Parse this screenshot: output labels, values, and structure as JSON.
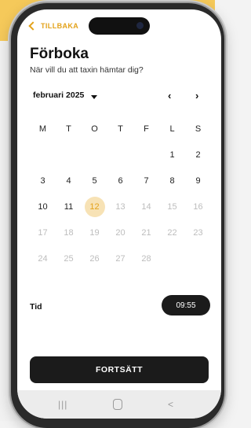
{
  "header": {
    "back_label": "TILLBAKA",
    "title": "Förboka",
    "subtitle": "När vill du att taxin hämtar dig?"
  },
  "calendar": {
    "month_label": "februari 2025",
    "prev_icon": "chevron-left-icon",
    "next_icon": "chevron-right-icon",
    "weekdays": [
      "M",
      "T",
      "O",
      "T",
      "F",
      "L",
      "S"
    ],
    "weeks": [
      [
        "",
        "",
        "",
        "",
        "",
        "1",
        "2"
      ],
      [
        "3",
        "4",
        "5",
        "6",
        "7",
        "8",
        "9"
      ],
      [
        "10",
        "11",
        "12",
        "13",
        "14",
        "15",
        "16"
      ],
      [
        "17",
        "18",
        "19",
        "20",
        "21",
        "22",
        "23"
      ],
      [
        "24",
        "25",
        "26",
        "27",
        "28",
        "",
        ""
      ]
    ],
    "selected_day": "12",
    "accent_color": "#e3a21a",
    "selected_bg": "#f7e2b5"
  },
  "time": {
    "label": "Tid",
    "value": "09:55"
  },
  "actions": {
    "continue_label": "FORTSÄTT"
  },
  "system_nav": {
    "recent_glyph": "|||",
    "back_glyph": "<"
  }
}
